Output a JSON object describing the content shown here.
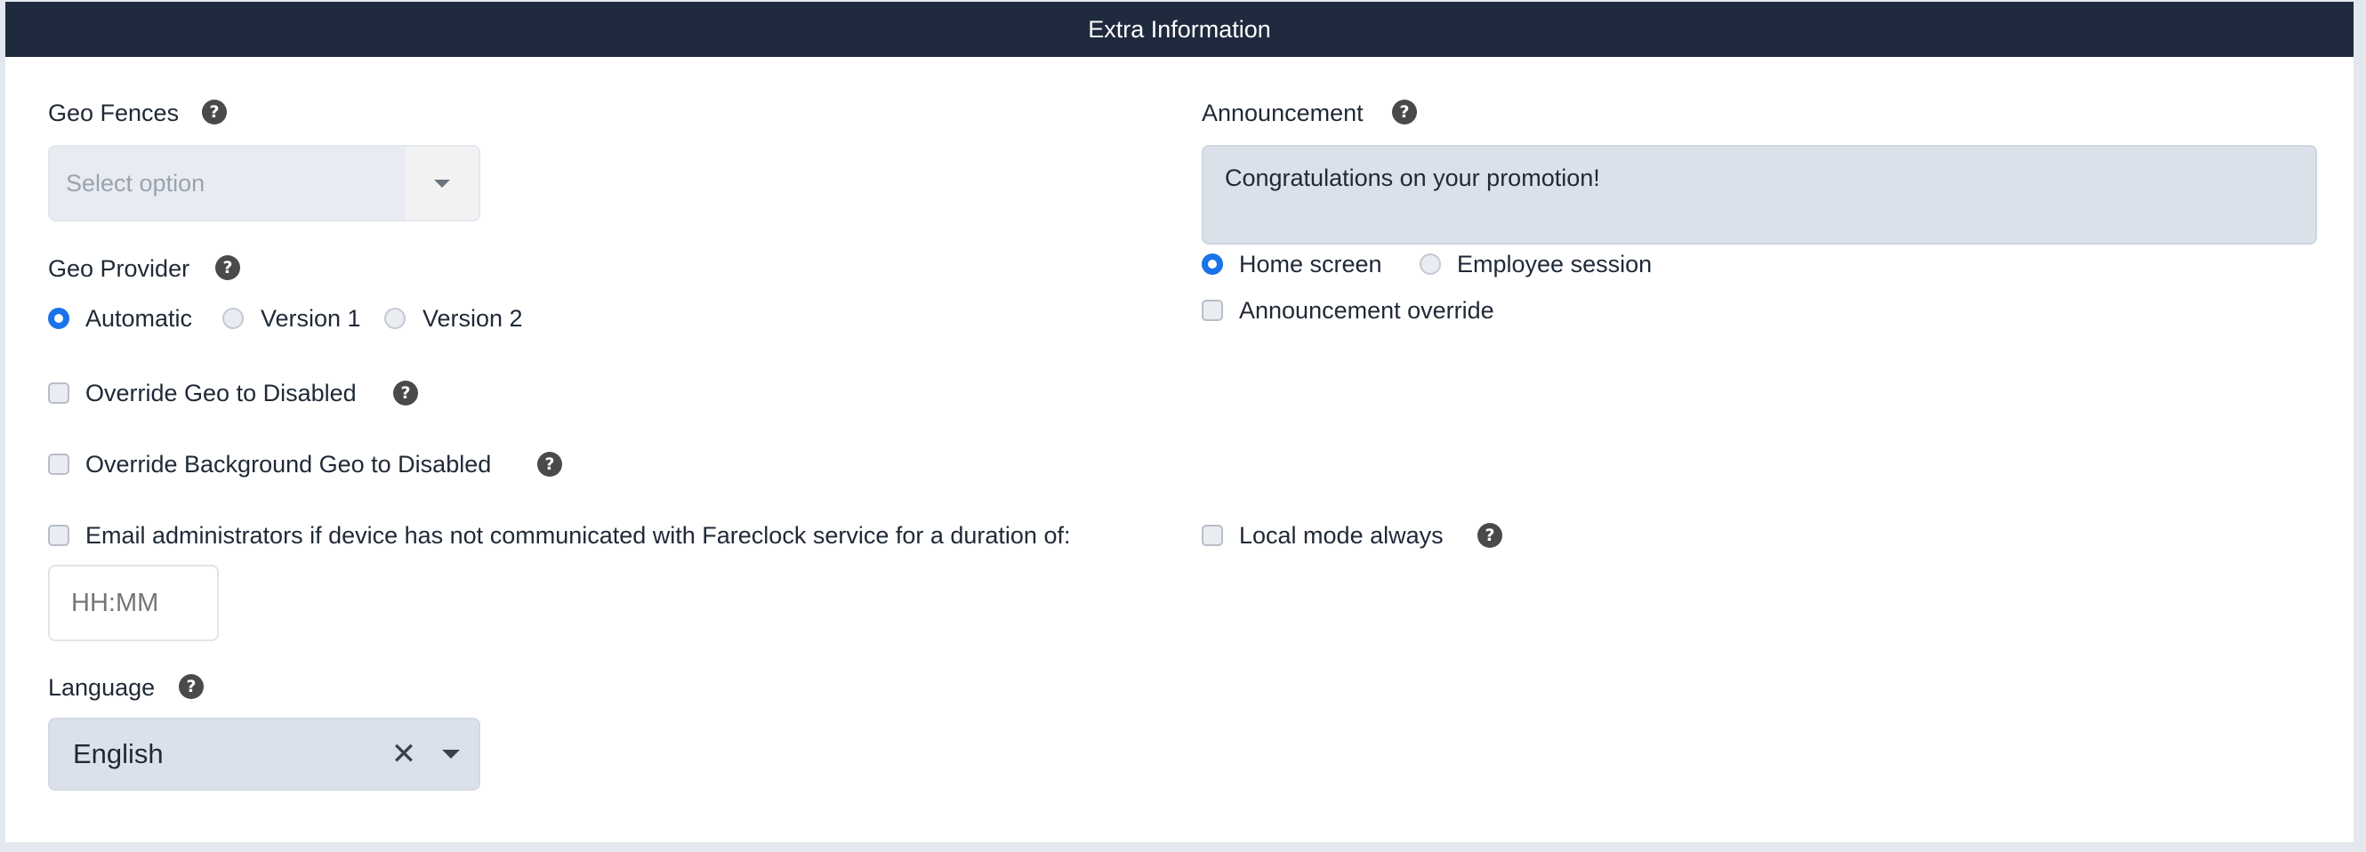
{
  "header": {
    "title": "Extra Information"
  },
  "geo_fences": {
    "label": "Geo Fences",
    "placeholder": "Select option"
  },
  "geo_provider": {
    "label": "Geo Provider",
    "options": [
      "Automatic",
      "Version 1",
      "Version 2"
    ],
    "selected": "Automatic"
  },
  "override_geo": {
    "label": "Override Geo to Disabled",
    "checked": false
  },
  "override_bg_geo": {
    "label": "Override Background Geo to Disabled",
    "checked": false
  },
  "email_admins": {
    "label": "Email administrators if device has not communicated with Fareclock service for a duration of:",
    "checked": false,
    "duration_placeholder": "HH:MM"
  },
  "language": {
    "label": "Language",
    "value": "English"
  },
  "announcement": {
    "label": "Announcement",
    "text": "Congratulations on your promotion!",
    "display_options": [
      "Home screen",
      "Employee session"
    ],
    "selected": "Home screen",
    "override_label": "Announcement override"
  },
  "local_mode": {
    "label": "Local mode always",
    "checked": false
  },
  "icons": {
    "help": "help-icon",
    "dropdown": "caret-down-icon",
    "clear": "clear-icon"
  },
  "colors": {
    "header_bg": "#1f2a3e",
    "accent": "#1a73e8"
  }
}
